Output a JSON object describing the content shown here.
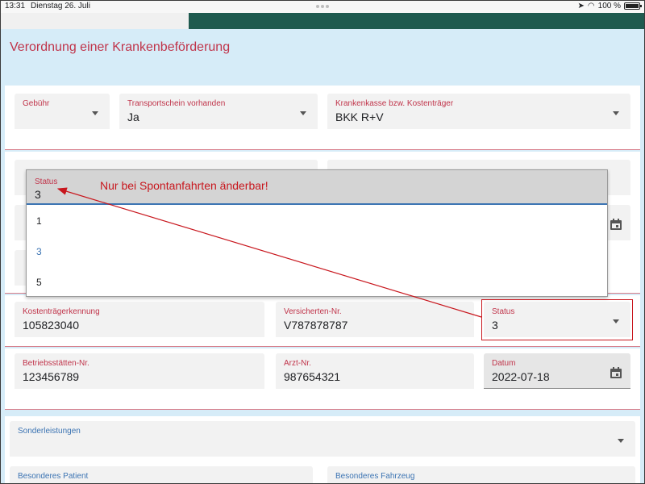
{
  "statusbar": {
    "time": "13:31",
    "date": "Dienstag 26. Juli",
    "battery": "100 %"
  },
  "dialog": {
    "title": "Verordnung einer Krankenbeförderung"
  },
  "row1": {
    "gebuehr_label": "Gebühr",
    "transport_label": "Transportschein vorhanden",
    "transport_value": "Ja",
    "kasse_label": "Krankenkasse bzw. Kostenträger",
    "kasse_value": "BKK R+V"
  },
  "row3": {
    "kennung_label": "Kostenträgerkennung",
    "kennung_value": "105823040",
    "versnr_label": "Versicherten-Nr.",
    "versnr_value": "V787878787",
    "status_label": "Status",
    "status_value": "3"
  },
  "row4": {
    "betrieb_label": "Betriebsstätten-Nr.",
    "betrieb_value": "123456789",
    "arzt_label": "Arzt-Nr.",
    "arzt_value": "987654321",
    "datum_label": "Datum",
    "datum_value": "2022-07-18"
  },
  "row5": {
    "sonder_label": "Sonderleistungen",
    "patient_label": "Besonderes Patient",
    "fahrzeug_label": "Besonderes Fahrzeug"
  },
  "dropdown": {
    "label": "Status",
    "value": "3",
    "options": [
      "1",
      "3",
      "5"
    ]
  },
  "annotation": {
    "text": "Nur bei Spontanfahrten änderbar!"
  },
  "colors": {
    "accent_red": "#c0344a",
    "accent_blue": "#3c74b3",
    "annotation_red": "#c8161d"
  }
}
